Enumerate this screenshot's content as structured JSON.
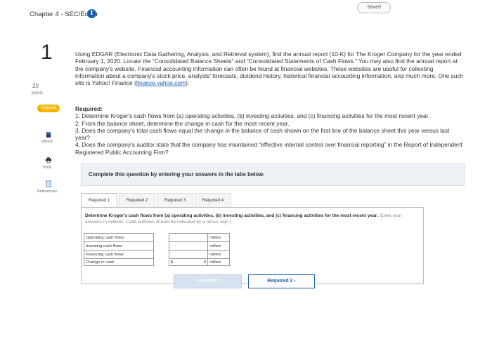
{
  "header": {
    "chapter_title": "Chapter 4 - SEC/Edgar",
    "info_icon": "i",
    "saved_label": "Saved"
  },
  "question": {
    "number": "1",
    "points_value": "20",
    "points_label": "points",
    "status": "Skipped"
  },
  "sidebar": {
    "ebook_label": "eBook",
    "print_label": "Print",
    "references_label": "References"
  },
  "intro": {
    "text": "Using EDGAR (Electronic Data Gathering, Analysis, and Retrieval system), find the annual report (10-K) for The Kroger Company for the year ended February 1, 2020. Locate the “Consolidated Balance Sheets” and “Consolidated Statements of Cash Flows.” You may also find the annual report at the company's website. Financial accounting information can often be found at financial websites. These websites are useful for collecting information about a company's stock price, analysts' forecasts, dividend history, historical financial accounting information, and much more. One such site is Yahoo! Finance (",
    "link": "finance.yahoo.com",
    "suffix": ")."
  },
  "required": {
    "heading": "Required:",
    "items": [
      "1. Determine Kroger's cash flows from (a) operating activities, (b) investing activities, and (c) financing activities for the most recent year.",
      "2. From the balance sheet, determine the change in cash for the most recent year.",
      "3. Does the company's total cash flows equal the change in the balance of cash shown on the first line of the balance sheet this year versus last year?",
      "4. Does the company's auditor state that the company has maintained “effective internal control over financial reporting” in the Report of Independent Registered Public Accounting Firm?"
    ]
  },
  "instruction": "Complete this question by entering your answers in the tabs below.",
  "tabs": [
    {
      "label": "Required 1",
      "active": true
    },
    {
      "label": "Required 2",
      "active": false
    },
    {
      "label": "Required 3",
      "active": false
    },
    {
      "label": "Required 4",
      "active": false
    }
  ],
  "panel": {
    "description_bold": "Determine Kroger's cash flows from (a) operating activities, (b) investing activities, and (c) financing activities for the most recent year.",
    "description_hint": "(Enter your answers in millions. Cash outflows should be indicated by a minus sign.)",
    "rows": [
      {
        "label": "Operating cash flows",
        "currency": "",
        "value": "",
        "unit": "million"
      },
      {
        "label": "Investing cash flows",
        "currency": "",
        "value": "",
        "unit": "million"
      },
      {
        "label": "Financing cash flows",
        "currency": "",
        "value": "",
        "unit": "million"
      },
      {
        "label": "Change in cash",
        "currency": "$",
        "value": "0",
        "unit": "million"
      }
    ]
  },
  "nav": {
    "prev_label": "‹  Required 1",
    "next_label": "Required 2  ›"
  },
  "colors": {
    "accent": "#1a5fb4",
    "skipped": "#f4b400"
  }
}
